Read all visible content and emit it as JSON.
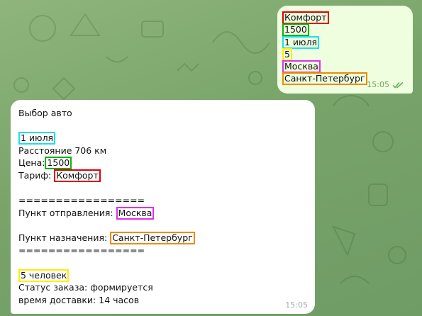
{
  "outgoing": {
    "lines": [
      "Комфорт",
      "1500",
      "1 июля",
      "5",
      "Москва",
      "Санкт-Петербург"
    ],
    "time": "15:05",
    "status_icon": "double-check-icon"
  },
  "incoming": {
    "title": "Выбор авто",
    "date": "1 июля",
    "distance": "Расстояние 706 км",
    "price_label": "Цена:",
    "price_value": "1500",
    "tariff_label": "Тариф:",
    "tariff_value": "Комфорт",
    "separator": "=================",
    "origin_label": "Пункт отправления:",
    "origin_value": "Москва",
    "destination_label": "Пункт назначения:",
    "destination_value": "Санкт-Петербург",
    "passengers": "5 человек",
    "order_status": "Статус заказа: формируется",
    "delivery_time": "время доставки: 14 часов",
    "time": "15:05"
  },
  "colors": {
    "background": "#78a46a",
    "outgoing_bubble": "#eefedf",
    "incoming_bubble": "#ffffff",
    "highlight_red": "#e00000",
    "highlight_green": "#10b010",
    "highlight_cyan": "#18e0f0",
    "highlight_yellow": "#ffee00",
    "highlight_magenta": "#e030e8",
    "highlight_orange": "#f08a00"
  }
}
